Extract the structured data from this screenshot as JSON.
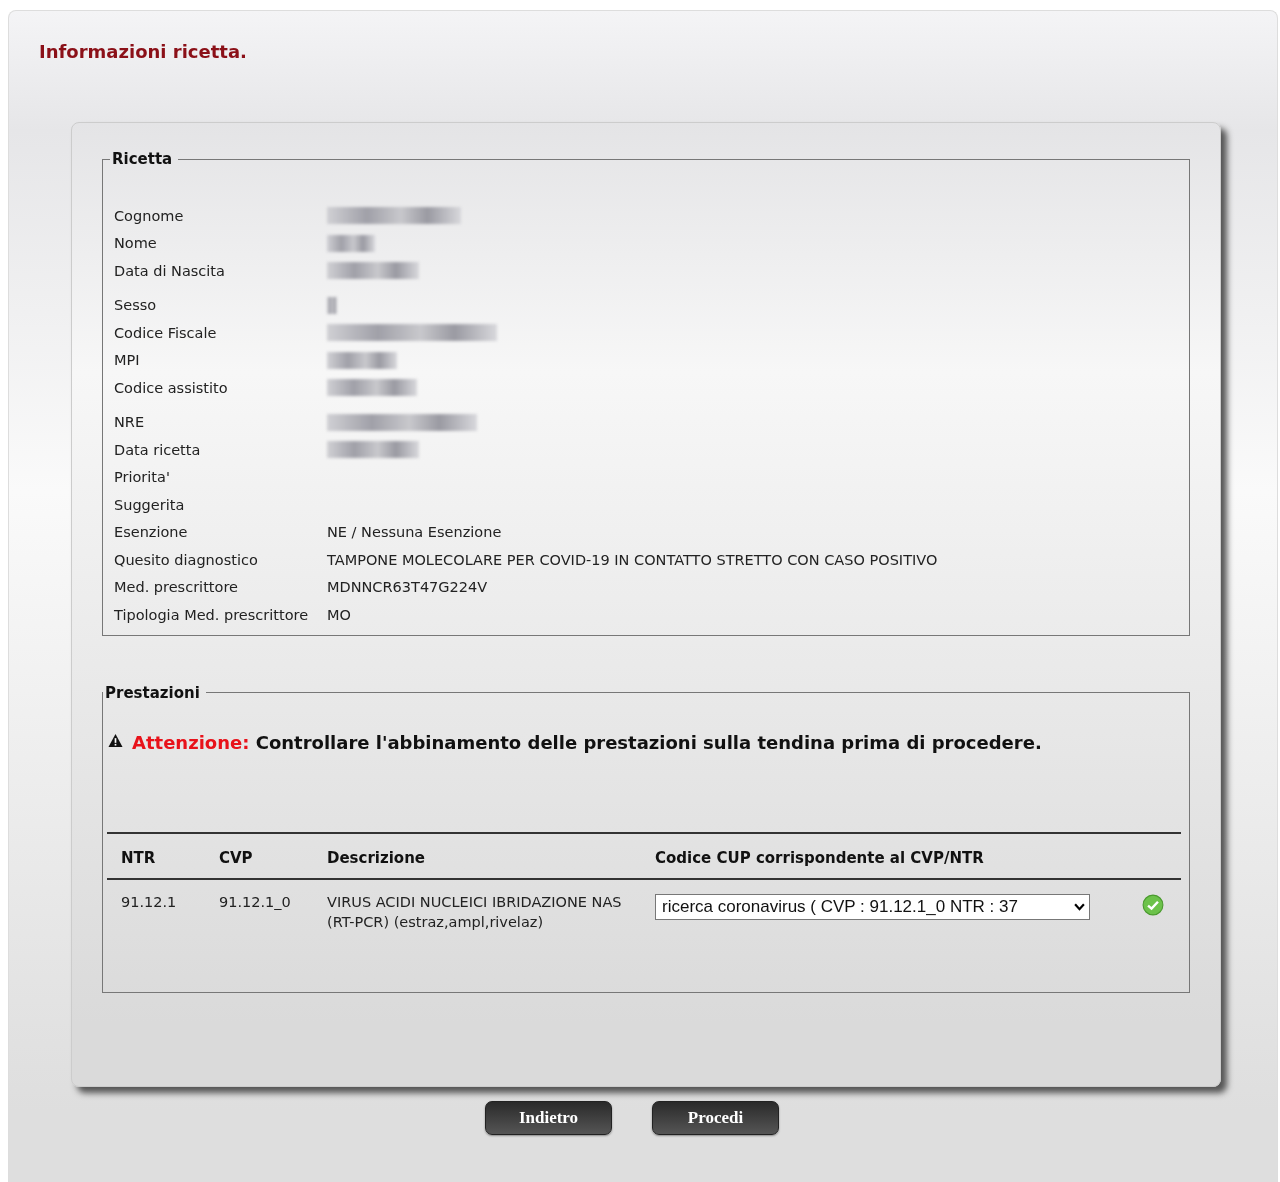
{
  "page_title": "Informazioni ricetta.",
  "ricetta": {
    "legend": "Ricetta",
    "groups": [
      [
        {
          "label": "Cognome",
          "blurred": true
        },
        {
          "label": "Nome",
          "blurred": true
        },
        {
          "label": "Data di Nascita",
          "blurred": true
        }
      ],
      [
        {
          "label": "Sesso",
          "blurred": true
        },
        {
          "label": "Codice Fiscale",
          "blurred": true
        },
        {
          "label": "MPI",
          "blurred": true
        },
        {
          "label": "Codice assistito",
          "blurred": true
        }
      ],
      [
        {
          "label": "NRE",
          "blurred": true
        },
        {
          "label": "Data ricetta",
          "blurred": true
        },
        {
          "label": "Priorita'",
          "blurred": false
        },
        {
          "label": "Suggerita",
          "blurred": false
        },
        {
          "label": "Esenzione",
          "value": "NE / Nessuna Esenzione",
          "blurred": false
        },
        {
          "label": "Quesito diagnostico",
          "value": "TAMPONE MOLECOLARE PER COVID-19 IN CONTATTO STRETTO CON CASO POSITIVO",
          "blurred": false
        },
        {
          "label": "Med. prescrittore",
          "value": "MDNNCR63T47G224V",
          "blurred": false
        },
        {
          "label": "Tipologia Med. prescrittore",
          "value": "MO",
          "blurred": false
        }
      ]
    ]
  },
  "prestazioni": {
    "legend": "Prestazioni",
    "warning_label": "Attenzione:",
    "warning_text": "Controllare l'abbinamento delle prestazioni sulla tendina prima di procedere.",
    "table": {
      "columns": [
        "NTR",
        "CVP",
        "Descrizione",
        "Codice CUP corrispondente al CVP/NTR"
      ],
      "rows": [
        {
          "ntr": "91.12.1",
          "cvp": "91.12.1_0",
          "descrizione": "VIRUS ACIDI NUCLEICI IBRIDAZIONE NAS (RT-PCR) (estraz,ampl,rivelaz)",
          "cup": "ricerca coronavirus ( CVP : 91.12.1_0 NTR : 37",
          "ok": true
        }
      ]
    }
  },
  "buttons": [
    "Indietro",
    "Procedi"
  ]
}
